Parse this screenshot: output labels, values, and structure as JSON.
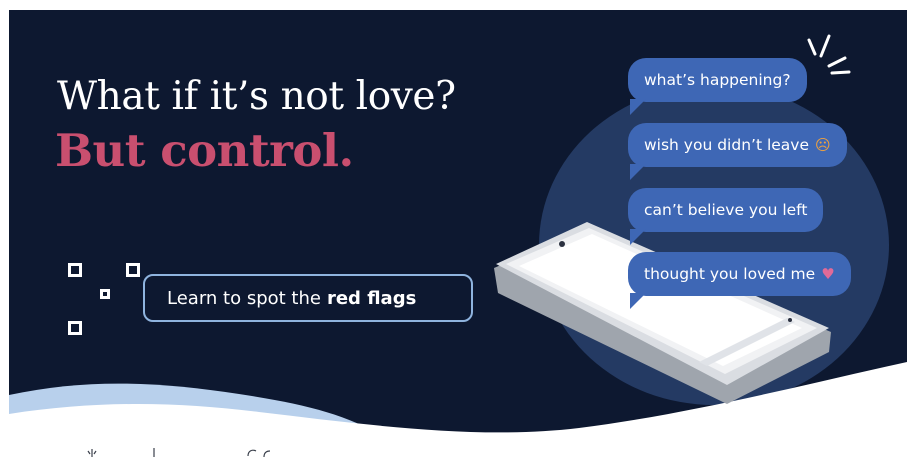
{
  "headline": {
    "line1": "What if it’s not love?",
    "line2": "But control."
  },
  "cta": {
    "text": "Learn to spot the",
    "emphasis": "red flags"
  },
  "messages": [
    {
      "text": "what’s happening?",
      "emoji": ""
    },
    {
      "text": "wish you didn’t leave",
      "emoji": "☹"
    },
    {
      "text": "can’t believe you left",
      "emoji": ""
    },
    {
      "text": "thought you loved me",
      "emoji": "♥"
    }
  ],
  "icons": {
    "qr": "qr-code-icon",
    "sad_face": "frowning-face-emoji",
    "broken_heart": "broken-heart-emoji",
    "buzz": "notification-lines-icon",
    "phone": "smartphone-illustration"
  },
  "colors": {
    "background": "#0d1830",
    "headline_white": "#ffffff",
    "headline_accent": "#c94f6f",
    "bubble": "#3e67b5",
    "cta_border": "#8fb4df",
    "wave": "#b8d0ec"
  }
}
